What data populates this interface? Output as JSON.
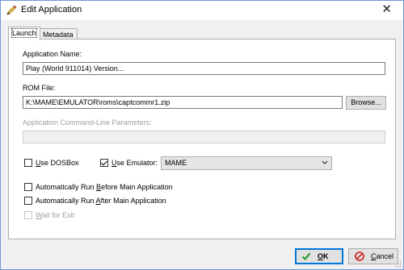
{
  "window": {
    "title": "Edit Application",
    "close_glyph": "✕"
  },
  "tabs": [
    {
      "label": "Launch",
      "active": true
    },
    {
      "label": "Metadata",
      "active": false
    }
  ],
  "form": {
    "app_name_label": "Application Name:",
    "app_name_value": "Play (World 911014) Version...",
    "rom_label": "ROM File:",
    "rom_value": "K:\\MAME\\EMULATOR\\roms\\captcommr1.zip",
    "browse_label": "Browse...",
    "cmdline_label": "Application Command-Line Parameters:",
    "cmdline_value": "",
    "use_dosbox": {
      "pre": "",
      "u": "U",
      "post": "se DOSBox",
      "checked": false
    },
    "use_emulator": {
      "pre": "",
      "u": "U",
      "post": "se Emulator:",
      "checked": true
    },
    "emulator_selected": "MAME",
    "run_before": {
      "pre": "Automatically Run ",
      "u": "B",
      "post": "efore Main Application",
      "checked": false
    },
    "run_after": {
      "pre": "Automatically Run ",
      "u": "A",
      "post": "fter Main Application",
      "checked": false
    },
    "wait_exit": {
      "pre": "",
      "u": "W",
      "post": "ait for Exit",
      "checked": false,
      "disabled": true
    }
  },
  "footer": {
    "ok": {
      "u": "O",
      "post": "K"
    },
    "cancel": {
      "u": "C",
      "post": "ancel"
    }
  },
  "icons": {
    "title": "pencil-icon",
    "ok": "checkmark-icon",
    "cancel": "cancel-icon"
  },
  "colors": {
    "accent": "#0078d7",
    "ok_green": "#2e9e2e",
    "cancel_red": "#d32f2f"
  }
}
